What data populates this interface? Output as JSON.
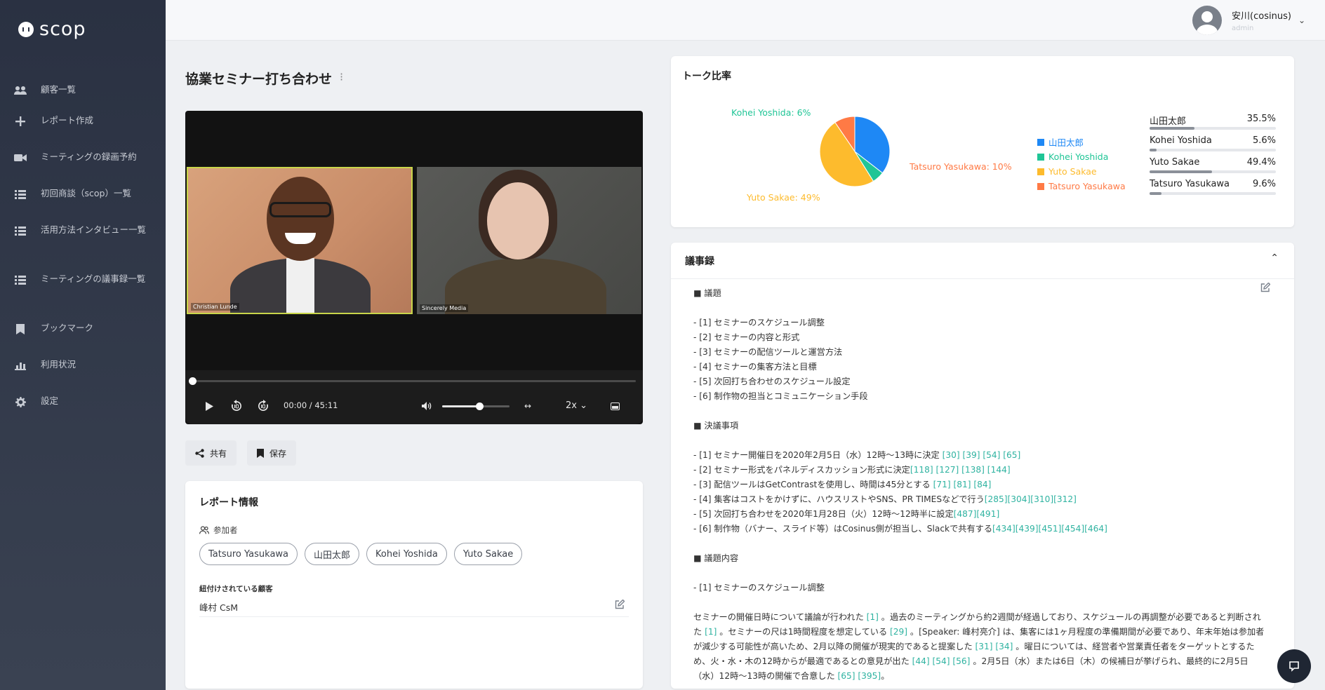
{
  "app": {
    "logo_text": "scop"
  },
  "sidebar": {
    "items": [
      {
        "label": "顧客一覧",
        "icon": "users-icon"
      },
      {
        "label": "レポート作成",
        "icon": "plus-icon"
      },
      {
        "label": "ミーティングの録画予約",
        "icon": "video-camera-icon"
      },
      {
        "label": "初回商談（scop）一覧",
        "icon": "list-icon"
      },
      {
        "label": "活用方法インタビュー一覧",
        "icon": "list-icon"
      },
      {
        "label": "ミーティングの議事録一覧",
        "icon": "list-icon"
      },
      {
        "label": "ブックマーク",
        "icon": "bookmark-icon"
      },
      {
        "label": "利用状況",
        "icon": "bar-chart-icon"
      },
      {
        "label": "設定",
        "icon": "gear-icon"
      }
    ]
  },
  "user": {
    "name": "安川(cosinus)",
    "role": "admin"
  },
  "page": {
    "title": "協業セミナー打ち合わせ",
    "menu_glyph": "⁝"
  },
  "video": {
    "tile1_label": "Christian Lunde",
    "tile2_label": "Sincerely Media",
    "time": "00:00 / 45:11",
    "speed": "2x",
    "progress_fraction": 0.0,
    "volume_fraction": 0.55
  },
  "actions": {
    "share": "共有",
    "save": "保存"
  },
  "report": {
    "title": "レポート情報",
    "participants_label": "参加者",
    "participants": [
      "Tatsuro Yasukawa",
      "山田太郎",
      "Kohei Yoshida",
      "Yuto Sakae"
    ],
    "linked_label": "紐付けされている顧客",
    "linked_value": "峰村 CsM"
  },
  "talk": {
    "title": "トーク比率",
    "legend": [
      {
        "name": "山田太郎",
        "color": "#1e88f5"
      },
      {
        "name": "Kohei Yoshida",
        "color": "#1fc596"
      },
      {
        "name": "Yuto Sakae",
        "color": "#fdbb2d"
      },
      {
        "name": "Tatsuro Yasukawa",
        "color": "#ff7a45"
      }
    ],
    "stats": [
      {
        "name": "山田太郎",
        "value": "35.5%",
        "fraction": 0.355
      },
      {
        "name": "Kohei Yoshida",
        "value": "5.6%",
        "fraction": 0.056
      },
      {
        "name": "Yuto Sakae",
        "value": "49.4%",
        "fraction": 0.494
      },
      {
        "name": "Tatsuro Yasukawa",
        "value": "9.6%",
        "fraction": 0.096
      }
    ],
    "pie_labels": {
      "kohei": "Kohei Yoshida: 6%",
      "tatsuro": "Tatsuro Yasukawa: 10%",
      "yuto": "Yuto Sakae: 49%"
    }
  },
  "minutes": {
    "title": "議事録",
    "collapse_glyph": "⌃",
    "agenda_header": "■ 議題",
    "agenda": [
      "- [1] セミナーのスケジュール調整",
      "- [2] セミナーの内容と形式",
      "- [3] セミナーの配信ツールと運営方法",
      "- [4] セミナーの集客方法と目標",
      "- [5] 次回打ち合わせのスケジュール設定",
      "- [6] 制作物の担当とコミュニケーション手段"
    ],
    "decisions_header": "■ 決議事項",
    "decisions": [
      {
        "text": "- [1] セミナー開催日を2020年2月5日（水）12時〜13時に決定 ",
        "refs": "[30]  [39]  [54]  [65]"
      },
      {
        "text": "- [2] セミナー形式をパネルディスカッション形式に決定",
        "refs": "[118] [127] [138] [144]"
      },
      {
        "text": "- [3] 配信ツールはGetContrastを使用し、時間は45分とする ",
        "refs": "[71]  [81]  [84]"
      },
      {
        "text": "- [4] 集客はコストをかけずに、ハウスリストやSNS、PR TIMESなどで行う",
        "refs": "[285][304][310][312]"
      },
      {
        "text": "- [5] 次回打ち合わせを2020年1月28日（火）12時〜12時半に設定",
        "refs": "[487][491]"
      },
      {
        "text": "- [6] 制作物（バナー、スライド等）はCosinus側が担当し、Slackで共有する",
        "refs": "[434][439][451][454][464]"
      }
    ],
    "content_header": "■ 議題内容",
    "content_sub": "- [1] セミナーのスケジュール調整",
    "paragraph": [
      {
        "t": "セミナーの開催日時について議論が行われた "
      },
      {
        "r": "[1]"
      },
      {
        "t": " 。過去のミーティングから約2週間が経過しており、スケジュールの再調整が必要であると判断された "
      },
      {
        "r": "[1]"
      },
      {
        "t": " 。セミナーの尺は1時間程度を想定している "
      },
      {
        "r": "[29]"
      },
      {
        "t": " 。[Speaker: 峰村亮介] は、集客には1ヶ月程度の準備期間が必要であり、年末年始は参加者が減少する可能性が高いため、2月以降の開催が現実的であると提案した "
      },
      {
        "r": "[31]  [34]"
      },
      {
        "t": " 。曜日については、経営者や営業責任者をターゲットとするため、火・水・木の12時からが最適であるとの意見が出た "
      },
      {
        "r": "[44]  [54]  [56]"
      },
      {
        "t": " 。2月5日（水）または6日（木）の候補日が挙げられ、最終的に2月5日（水）12時〜13時の開催で合意した "
      },
      {
        "r": "[65] [395]"
      },
      {
        "t": "。"
      }
    ]
  },
  "colors": {
    "accent_ref": "#2fb3a1",
    "sidebar_bg": "#2a3142"
  }
}
